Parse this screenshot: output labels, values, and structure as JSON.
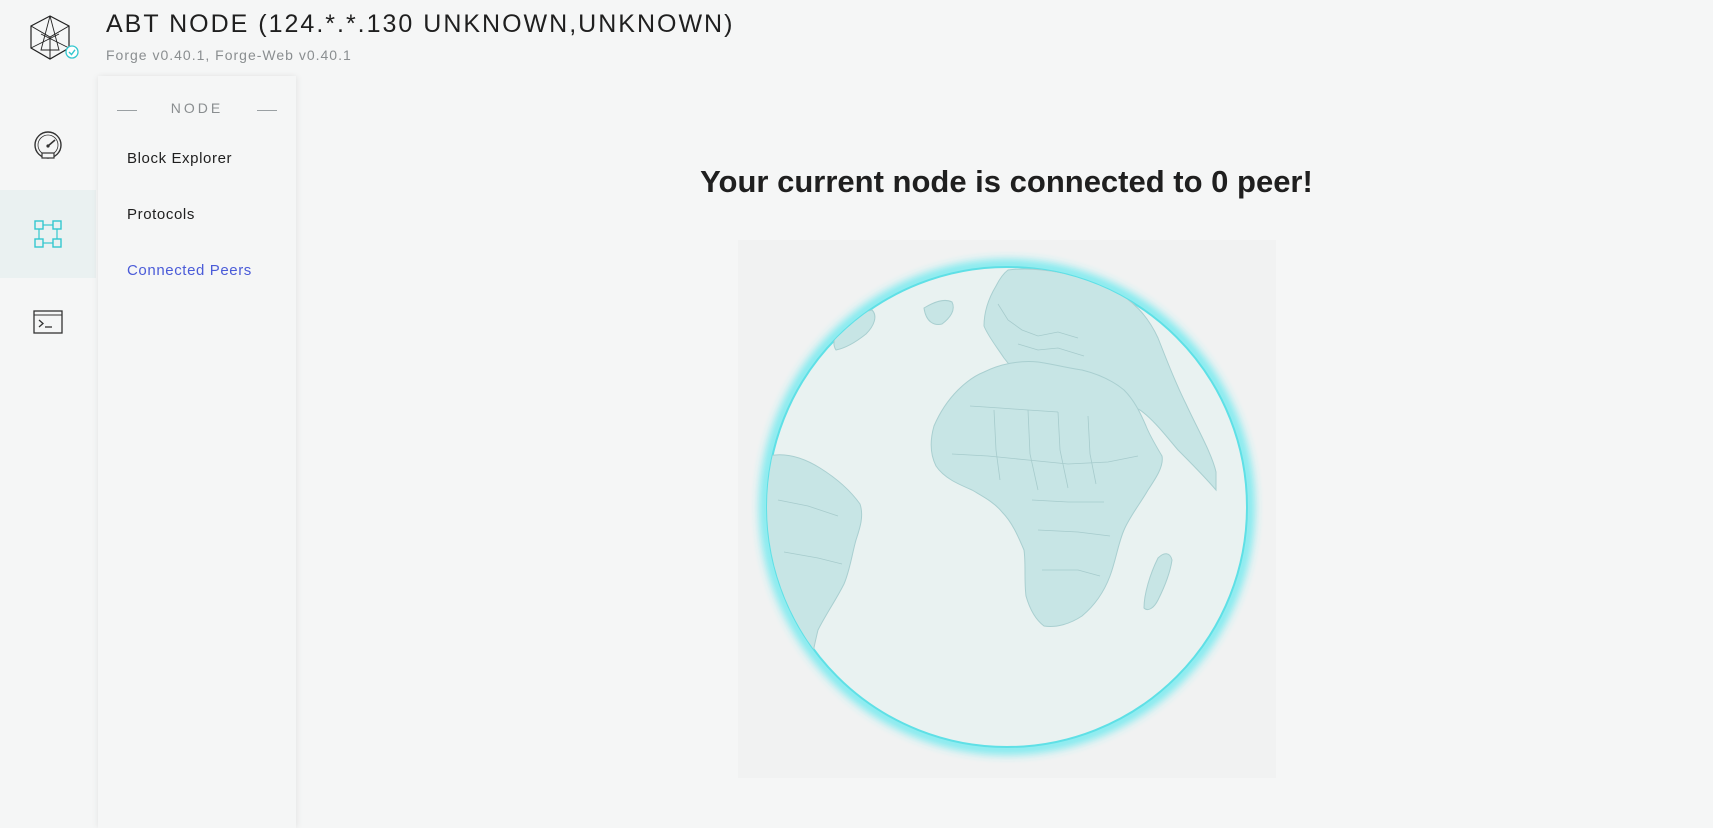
{
  "header": {
    "title": "ABT NODE (124.*.*.130 UNKNOWN,UNKNOWN)",
    "subtitle": "Forge v0.40.1, Forge-Web v0.40.1",
    "logo_icon": "abt-cube-logo-icon",
    "badge_icon": "check-badge-icon"
  },
  "rail": {
    "items": [
      {
        "icon": "dashboard-gauge-icon",
        "active": false
      },
      {
        "icon": "node-grid-icon",
        "active": true
      },
      {
        "icon": "terminal-icon",
        "active": false
      }
    ]
  },
  "subnav": {
    "heading": "NODE",
    "items": [
      {
        "label": "Block Explorer",
        "active": false
      },
      {
        "label": "Protocols",
        "active": false
      },
      {
        "label": "Connected Peers",
        "active": true
      }
    ]
  },
  "main": {
    "headline": "Your current node is connected to 0 peer!",
    "globe_icon": "earth-globe-icon"
  },
  "colors": {
    "accent": "#4a5bd8",
    "teal": "#33c7cf",
    "background": "#f5f6f6"
  }
}
